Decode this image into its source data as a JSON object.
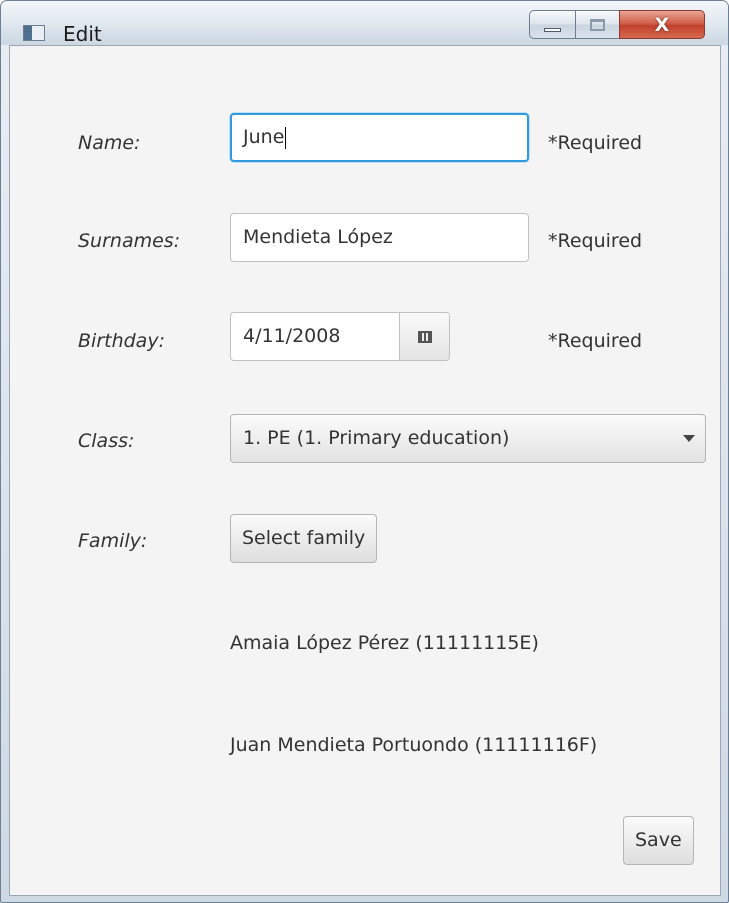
{
  "window": {
    "title": "Edit",
    "controls": {
      "minimize": "minimize",
      "maximize": "maximize",
      "close": "X"
    }
  },
  "form": {
    "name": {
      "label": "Name:",
      "value": "June",
      "required_text": "*Required"
    },
    "surnames": {
      "label": "Surnames:",
      "value": "Mendieta López",
      "required_text": "*Required"
    },
    "birthday": {
      "label": "Birthday:",
      "value": "4/11/2008",
      "required_text": "*Required",
      "picker_icon": "calendar-icon"
    },
    "class": {
      "label": "Class:",
      "selected": "1. PE (1. Primary education)",
      "arrow_icon": "chevron-down-icon"
    },
    "family": {
      "label": "Family:",
      "button_label": "Select family",
      "members": [
        "Amaia López Pérez (11111115E)",
        "Juan Mendieta Portuondo (11111116F)"
      ]
    },
    "save_label": "Save"
  },
  "colors": {
    "focus_ring": "#3399dd",
    "client_background": "#f4f4f4",
    "close_button": "#c1412b"
  }
}
